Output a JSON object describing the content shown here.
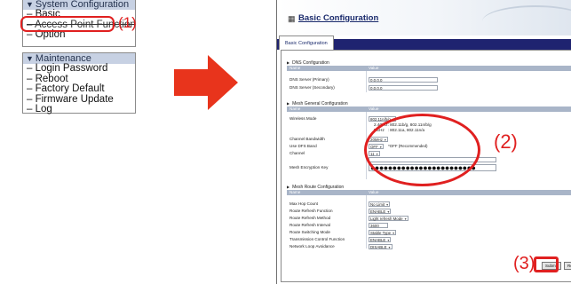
{
  "menu": {
    "system_config": {
      "header": "System Configuration",
      "items": [
        "Basic",
        "Access Point Function",
        "Option"
      ]
    },
    "maintenance": {
      "header": "Maintenance",
      "items": [
        "Login Password",
        "Reboot",
        "Factory Default",
        "Firmware Update",
        "Log"
      ]
    }
  },
  "callouts": {
    "one": "(1)",
    "two": "(2)",
    "three": "(3)"
  },
  "colors": {
    "callout": "#e02020",
    "arrow": "#e8341c",
    "navbar": "#1f2370",
    "table_header": "#a9b5c8",
    "menu_header": "#c7d1e3"
  },
  "icons": {
    "page_icon": "grid-icon",
    "arrow": "right-arrow-icon"
  },
  "window": {
    "title": "Basic Configuration",
    "tab": "Basic Configuration"
  },
  "dns": {
    "title": "DNS Configuration",
    "col_name": "Name",
    "col_value": "Value",
    "rows": [
      {
        "label": "DNS Server (Primary)",
        "value": "0.0.0.0"
      },
      {
        "label": "DNS Server (Secondary)",
        "value": "0.0.0.0"
      }
    ]
  },
  "mesh_general": {
    "title": "Mesh General Configuration",
    "col_name": "Name",
    "col_value": "Value",
    "wireless_mode_label": "Wireless Mode",
    "wireless_mode_value": "802.11n/b/g",
    "wireless_mode_note1": "2.4GHz: 802.11b/g, 802.11n/b/g",
    "wireless_mode_note2": "5GHz   : 802.11a, 802.11n/a",
    "channel_bandwidth_label": "Channel Bandwidth",
    "channel_bandwidth_value": "20MHz",
    "use_dfs_label": "Use DFS Band",
    "use_dfs_value": "OFF",
    "use_dfs_hint": "*OFF (Recommended)",
    "channel_label": "Channel",
    "channel_value": "11",
    "encryption_label": "Mesh Encryption Key",
    "encryption_value": "●●●●●●●●●●●●●●●●●●●●●●●●"
  },
  "mesh_route": {
    "title": "Mesh Route Configuration",
    "col_name": "Name",
    "col_value": "Value",
    "rows": [
      {
        "label": "Max Hop Count",
        "value": "No Limit"
      },
      {
        "label": "Route Refresh Function",
        "value": "ENABLE"
      },
      {
        "label": "Route Refresh Method",
        "value": "Light refresh Mode"
      },
      {
        "label": "Route Refresh Interval",
        "value": "3600"
      },
      {
        "label": "Route Switching Mode",
        "value": "Stable Type"
      },
      {
        "label": "Transmission Control Function",
        "value": "ENABLE"
      },
      {
        "label": "Network Loop Avoidance",
        "value": "DISABLE"
      }
    ]
  },
  "buttons": {
    "submit": "Submit",
    "reset": "Reset"
  }
}
